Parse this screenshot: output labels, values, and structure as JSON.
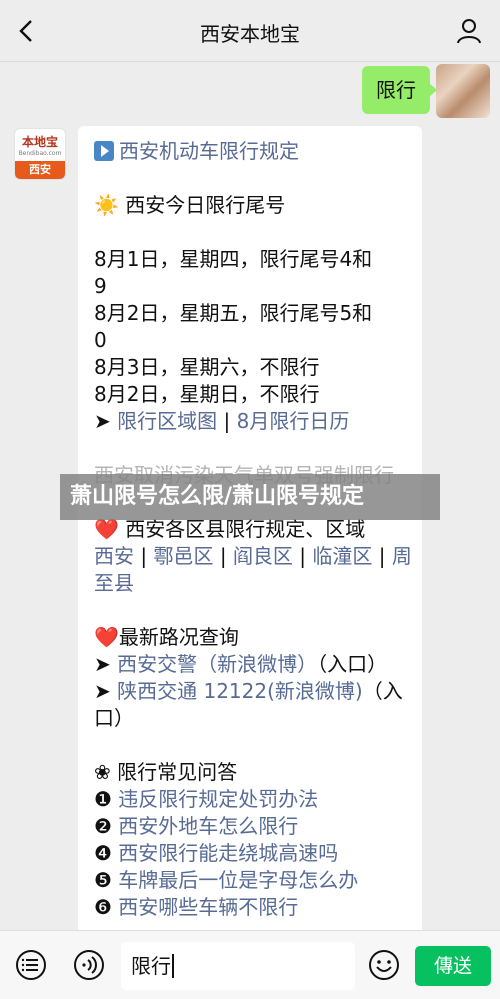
{
  "header": {
    "title": "西安本地宝",
    "back_icon": "chevron-left-icon",
    "profile_icon": "person-icon"
  },
  "user_message": {
    "text": "限行"
  },
  "bot": {
    "avatar_logo_top": "本地宝",
    "avatar_logo_url": "Bendibao.com",
    "avatar_logo_bottom": "西安"
  },
  "message": {
    "rules_link": "西安机动车限行规定",
    "today_heading": "西安今日限行尾号",
    "schedule": [
      "8月1日，星期四，限行尾号4和",
      "9",
      "8月2日，星期五，限行尾号5和",
      "0",
      "8月3日，星期六，不限行",
      "8月2日，星期日，不限行"
    ],
    "links_row1": {
      "arrow": "➤",
      "a": "限行区域图",
      "b": "8月限行日历"
    },
    "faded_line": "西安取消污染天气单双号强制限行",
    "districts_heading": "西安各区县限行规定、区域",
    "districts": [
      "西安",
      "鄠邑区",
      "阎良区",
      "临潼区",
      "周",
      "至县"
    ],
    "traffic_heading": "最新路况查询",
    "traffic_1_link": "西安交警（新浪微博）",
    "traffic_1_suffix": "（入口）",
    "traffic_2_link": "陕西交通 12122(新浪微博)",
    "traffic_2_suffix": "（入",
    "traffic_2_wrap": "口）",
    "faq_heading": "限行常见问答",
    "faq": [
      {
        "num": "❶",
        "text": "违反限行规定处罚办法"
      },
      {
        "num": "❷",
        "text": "西安外地车怎么限行"
      },
      {
        "num": "❹",
        "text": "西安限行能走绕城高速吗"
      },
      {
        "num": "❺",
        "text": "车牌最后一位是字母怎么办"
      },
      {
        "num": "❻",
        "text": "西安哪些车辆不限行"
      }
    ]
  },
  "overlay": {
    "text": "萧山限号怎么限/萧山限号规定"
  },
  "bottom": {
    "input_value": "限行",
    "send_label": "傳送"
  },
  "colors": {
    "accent": "#07c160",
    "link": "#576b95",
    "user_bubble": "#95ec69"
  }
}
